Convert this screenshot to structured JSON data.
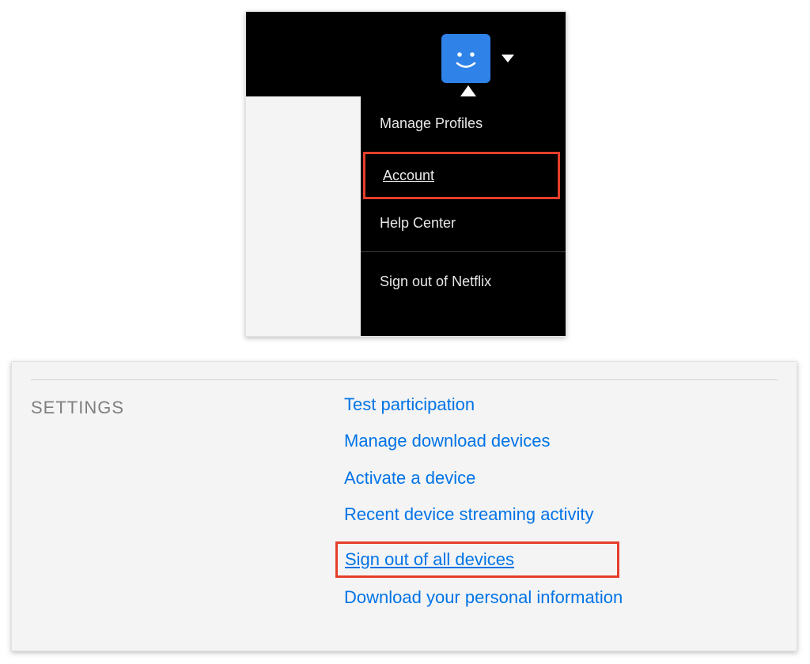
{
  "dropdown": {
    "manage_profiles": "Manage Profiles",
    "account": "Account",
    "help_center": "Help Center",
    "sign_out": "Sign out of Netflix"
  },
  "settings": {
    "heading": "SETTINGS",
    "links": {
      "test_participation": "Test participation",
      "manage_download_devices": "Manage download devices",
      "activate_device": "Activate a device",
      "recent_activity": "Recent device streaming activity",
      "sign_out_all": "Sign out of all devices",
      "download_personal": "Download your personal information"
    }
  },
  "colors": {
    "highlight": "#e63e2a",
    "link": "#0073e6",
    "avatar": "#2f82e8"
  }
}
